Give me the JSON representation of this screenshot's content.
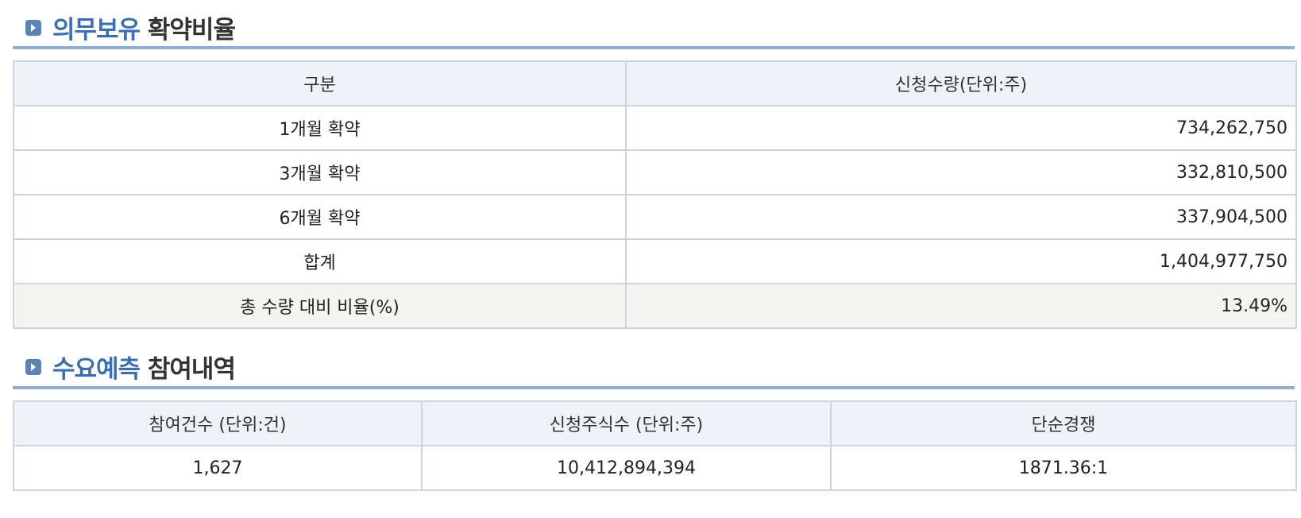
{
  "lockup_section": {
    "title_accent": "의무보유",
    "title_rest": "확약비율",
    "bullet_icon": "chevron-right-icon",
    "columns": [
      "구분",
      "신청수량(단위:주)"
    ],
    "rows": [
      {
        "label": "1개월 확약",
        "value": "734,262,750"
      },
      {
        "label": "3개월 확약",
        "value": "332,810,500"
      },
      {
        "label": "6개월 확약",
        "value": "337,904,500"
      },
      {
        "label": "합계",
        "value": "1,404,977,750"
      },
      {
        "label": "총 수량 대비 비율(%)",
        "value": "13.49%"
      }
    ]
  },
  "demand_section": {
    "title_accent": "수요예측",
    "title_rest": "참여내역",
    "bullet_icon": "chevron-right-icon",
    "columns": [
      "참여건수 (단위:건)",
      "신청주식수 (단위:주)",
      "단순경쟁"
    ],
    "row": {
      "participants": "1,627",
      "shares_requested": "10,412,894,394",
      "competition_ratio": "1871.36:1"
    }
  },
  "colors": {
    "accent": "#3d6fae",
    "header_underline": "#8fb0d4",
    "table_border": "#cbd5e1",
    "table_header_bg": "#eff3f7",
    "ratio_row_bg": "#f4f4f1"
  }
}
